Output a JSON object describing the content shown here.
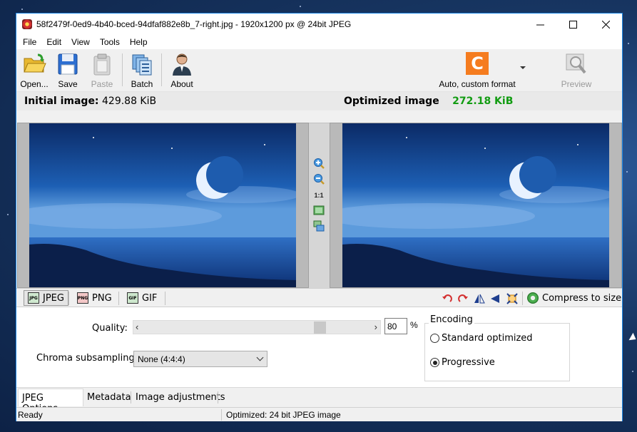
{
  "window": {
    "title": "58f2479f-0ed9-4b40-bced-94dfaf882e8b_7-right.jpg - 1920x1200 px @ 24bit JPEG",
    "controls": [
      "minimize-icon",
      "maximize-icon",
      "close-icon"
    ]
  },
  "menu": {
    "items": [
      {
        "label": "File"
      },
      {
        "label": "Edit"
      },
      {
        "label": "View"
      },
      {
        "label": "Tools"
      },
      {
        "label": "Help"
      }
    ]
  },
  "toolbar": {
    "open": {
      "label": "Open...",
      "icon": "folder-icon"
    },
    "save": {
      "label": "Save",
      "icon": "floppy-disk-icon"
    },
    "paste": {
      "label": "Paste",
      "icon": "clipboard-icon",
      "disabled": true
    },
    "batch": {
      "label": "Batch",
      "icon": "batch-icon"
    },
    "about": {
      "label": "About",
      "icon": "person-icon"
    },
    "format": {
      "letter": "C",
      "label": "Auto, custom format",
      "color": "#f57c1f"
    },
    "preview": {
      "label": "Preview",
      "icon": "magnifier-icon",
      "disabled": true
    }
  },
  "header": {
    "initial_label": "Initial image:",
    "initial_size": "429.88 KiB",
    "optimized_label": "Optimized image",
    "optimized_size": "272.18 KiB",
    "optimized_color": "#129c12"
  },
  "viewer": {
    "zoom_in_icon": "zoom-in-icon",
    "zoom_out_icon": "zoom-out-icon",
    "actual_size_label": "1:1",
    "fit_icon": "fit-window-icon",
    "swap_icon": "swap-view-icon"
  },
  "format_tabs": {
    "jpeg": {
      "label": "JPEG",
      "icon": "jpeg-icon"
    },
    "png": {
      "label": "PNG",
      "icon": "png-icon"
    },
    "gif": {
      "label": "GIF",
      "icon": "gif-icon"
    },
    "tools": [
      "rotate-left-icon",
      "rotate-right-icon",
      "flip-horizontal-icon",
      "flip-vertical-icon",
      "resize-icon"
    ],
    "compress_label": "Compress to size"
  },
  "jpeg_options": {
    "quality_label": "Quality:",
    "quality_value": "80",
    "quality_unit": "%",
    "quality_fraction": 0.8,
    "chroma_label": "Chroma subsampling:",
    "chroma_value": "None (4:4:4)",
    "encoding_title": "Encoding",
    "encoding_options": [
      {
        "label": "Standard optimized",
        "checked": false
      },
      {
        "label": "Progressive",
        "checked": true
      }
    ]
  },
  "bottom_tabs": [
    {
      "label": "JPEG Options",
      "active": true
    },
    {
      "label": "Metadata",
      "active": false
    },
    {
      "label": "Image adjustments",
      "active": false
    }
  ],
  "status": {
    "left": "Ready",
    "right": "Optimized: 24 bit JPEG image"
  }
}
